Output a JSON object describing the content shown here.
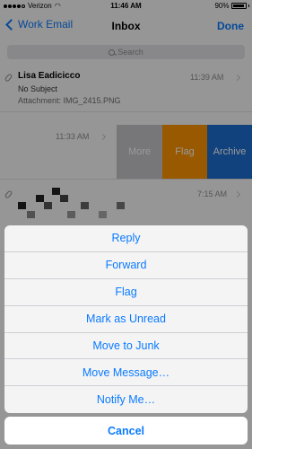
{
  "status_bar": {
    "carrier": "Verizon",
    "time": "11:46 AM",
    "battery": "90%"
  },
  "nav": {
    "back_label": "Work Email",
    "title": "Inbox",
    "done_label": "Done"
  },
  "search": {
    "placeholder": "Search"
  },
  "messages": [
    {
      "sender": "Lisa Eadicicco",
      "time": "11:39 AM",
      "subject": "No Subject",
      "preview": "Attachment: IMG_2415.PNG",
      "has_attachment": true
    },
    {
      "time": "11:33 AM",
      "swipe_actions": [
        "More",
        "Flag",
        "Archive"
      ]
    },
    {
      "time": "7:15 AM",
      "has_attachment": true
    }
  ],
  "swipe_colors": {
    "more": "#c7c7cc",
    "flag": "#ff9500",
    "archive": "#1d6fd0"
  },
  "action_sheet": {
    "items": [
      "Reply",
      "Forward",
      "Flag",
      "Mark as Unread",
      "Move to Junk",
      "Move Message…",
      "Notify Me…"
    ],
    "cancel_label": "Cancel"
  },
  "colors": {
    "accent": "#0a7aff"
  }
}
